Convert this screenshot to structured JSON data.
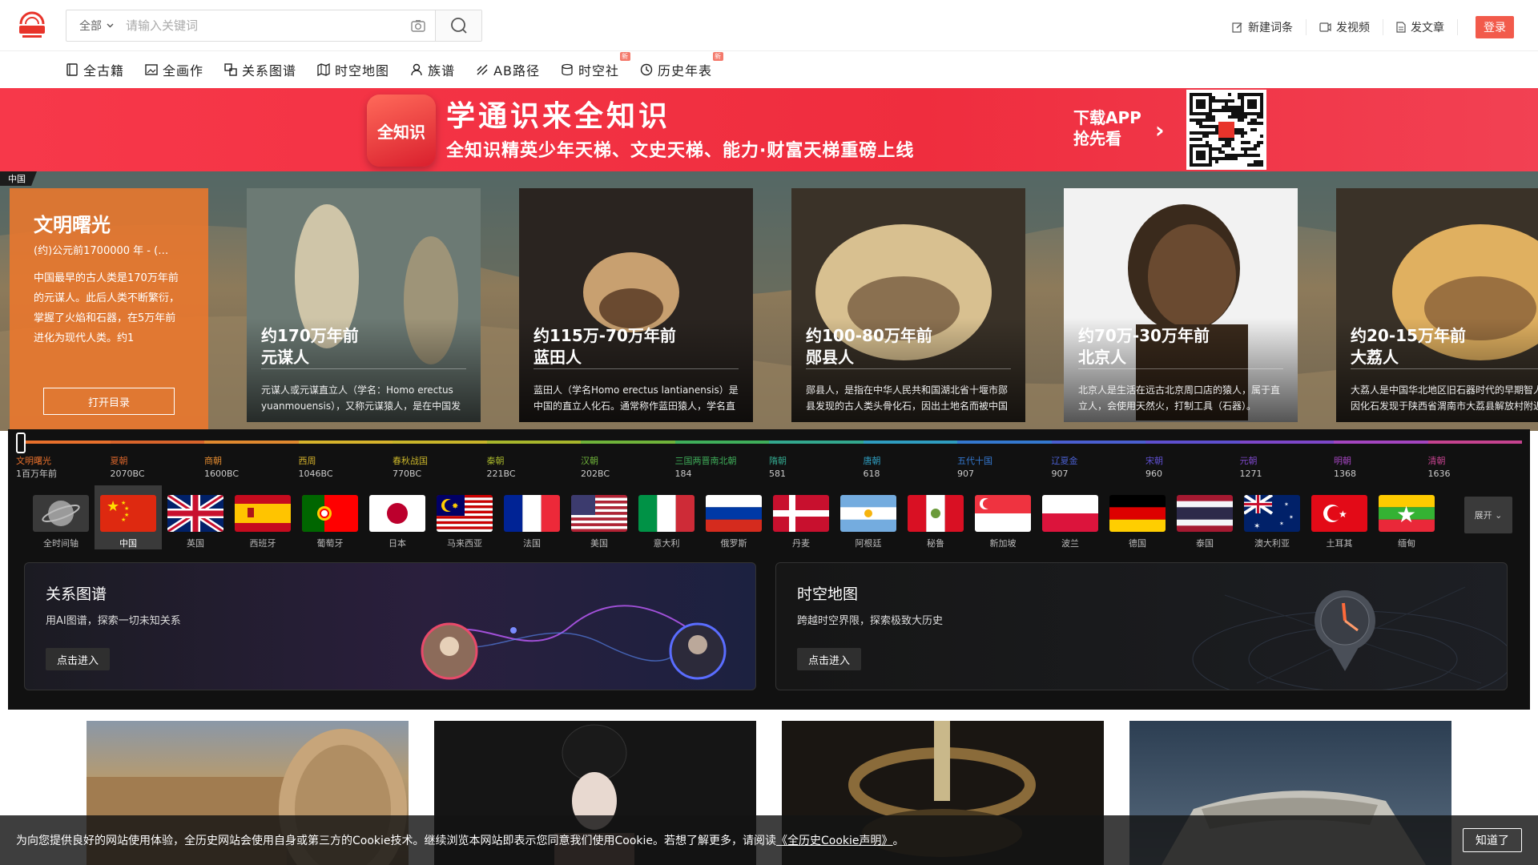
{
  "header": {
    "search_scope": "全部",
    "search_placeholder": "请输入关键词",
    "links": [
      {
        "icon": "edit-icon",
        "label": "新建词条"
      },
      {
        "icon": "video-icon",
        "label": "发视频"
      },
      {
        "icon": "article-icon",
        "label": "发文章"
      }
    ],
    "login": "登录"
  },
  "nav": [
    {
      "icon": "book-icon",
      "label": "全古籍",
      "new": false
    },
    {
      "icon": "painting-icon",
      "label": "全画作",
      "new": false
    },
    {
      "icon": "relation-icon",
      "label": "关系图谱",
      "new": false
    },
    {
      "icon": "map-icon",
      "label": "时空地图",
      "new": false
    },
    {
      "icon": "clan-icon",
      "label": "族谱",
      "new": false
    },
    {
      "icon": "path-icon",
      "label": "AB路径",
      "new": false
    },
    {
      "icon": "community-icon",
      "label": "时空社",
      "new": true
    },
    {
      "icon": "timeline-icon",
      "label": "历史年表",
      "new": true
    }
  ],
  "new_badge": "新",
  "banner": {
    "logo": "全知识",
    "headline": "学通识来全知识",
    "subline": "全知识精英少年天梯、文史天梯、能力·财富天梯重磅上线",
    "download_line1": "下载APP",
    "download_line2": "抢先看"
  },
  "hero": {
    "region_tag": "中国",
    "intro": {
      "title": "文明曙光",
      "range": "(约)公元前1700000 年 - (…",
      "desc": "中国最早的古人类是170万年前的元谋人。此后人类不断繁衍，掌握了火焰和石器，在5万年前进化为现代人类。约1",
      "button": "打开目录"
    },
    "cards": [
      {
        "period": "约170万年前",
        "name": "元谋人",
        "desc": "元谋人或元谋直立人（学名：Homo erectus yuanmouensis），又称元谋猿人，是在中国发"
      },
      {
        "period": "约115万-70万年前",
        "name": "蓝田人",
        "desc": "蓝田人（学名Homo erectus lantianensis）是中国的直立人化石。通常称作蓝田猿人，学名直"
      },
      {
        "period": "约100-80万年前",
        "name": "郧县人",
        "desc": "郧县人，是指在中华人民共和国湖北省十堰市郧县发现的古人类头骨化石，因出土地名而被中国"
      },
      {
        "period": "约70万-30万年前",
        "name": "北京人",
        "desc": "北京人是生活在远古北京周口店的猿人，属于直立人，会使用天然火，打制工具（石器）。"
      },
      {
        "period": "约20-15万年前",
        "name": "大荔人",
        "desc": "大荔人是中国华北地区旧石器时代的早期智人，因化石发现于陕西省渭南市大荔县解放村附近"
      }
    ]
  },
  "timeline": [
    {
      "name": "文明曙光",
      "year": "1百万年前",
      "color": "#e8702c"
    },
    {
      "name": "夏朝",
      "year": "2070BC",
      "color": "#d9652b"
    },
    {
      "name": "商朝",
      "year": "1600BC",
      "color": "#e0892f"
    },
    {
      "name": "西周",
      "year": "1046BC",
      "color": "#d6b32c"
    },
    {
      "name": "春秋战国",
      "year": "770BC",
      "color": "#c9b52a"
    },
    {
      "name": "秦朝",
      "year": "221BC",
      "color": "#a7b62c"
    },
    {
      "name": "汉朝",
      "year": "202BC",
      "color": "#6fb33a"
    },
    {
      "name": "三国两晋南北朝",
      "year": "184",
      "color": "#3fae5a"
    },
    {
      "name": "隋朝",
      "year": "581",
      "color": "#33a88e"
    },
    {
      "name": "唐朝",
      "year": "618",
      "color": "#2f9dc0"
    },
    {
      "name": "五代十国",
      "year": "907",
      "color": "#3478cf"
    },
    {
      "name": "辽夏金",
      "year": "907",
      "color": "#4a5fd0"
    },
    {
      "name": "宋朝",
      "year": "960",
      "color": "#5e4fcf"
    },
    {
      "name": "元朝",
      "year": "1271",
      "color": "#7d47c9"
    },
    {
      "name": "明朝",
      "year": "1368",
      "color": "#a345bf"
    },
    {
      "name": "清朝",
      "year": "1636",
      "color": "#c5438f"
    }
  ],
  "flags": [
    {
      "code": "all",
      "label": "全时间轴"
    },
    {
      "code": "cn",
      "label": "中国"
    },
    {
      "code": "gb",
      "label": "英国"
    },
    {
      "code": "es",
      "label": "西班牙"
    },
    {
      "code": "pt",
      "label": "葡萄牙"
    },
    {
      "code": "jp",
      "label": "日本"
    },
    {
      "code": "my",
      "label": "马来西亚"
    },
    {
      "code": "fr",
      "label": "法国"
    },
    {
      "code": "us",
      "label": "美国"
    },
    {
      "code": "it",
      "label": "意大利"
    },
    {
      "code": "ru",
      "label": "俄罗斯"
    },
    {
      "code": "dk",
      "label": "丹麦"
    },
    {
      "code": "ar",
      "label": "阿根廷"
    },
    {
      "code": "pe",
      "label": "秘鲁"
    },
    {
      "code": "sg",
      "label": "新加坡"
    },
    {
      "code": "pl",
      "label": "波兰"
    },
    {
      "code": "de",
      "label": "德国"
    },
    {
      "code": "th",
      "label": "泰国"
    },
    {
      "code": "au",
      "label": "澳大利亚"
    },
    {
      "code": "tr",
      "label": "土耳其"
    },
    {
      "code": "mm",
      "label": "缅甸"
    }
  ],
  "active_flag": "cn",
  "expand": "展开",
  "panels": [
    {
      "title": "关系图谱",
      "sub": "用AI图谱，探索一切未知关系",
      "button": "点击进入"
    },
    {
      "title": "时空地图",
      "sub": "跨越时空界限，探索极致大历史",
      "button": "点击进入"
    }
  ],
  "cookie": {
    "text_before": "为向您提供良好的网站使用体验，全历史网站会使用自身或第三方的Cookie技术。继续浏览本网站即表示您同意我们使用Cookie。若想了解更多，请阅读",
    "link": "《全历史Cookie声明》",
    "text_after": "。",
    "button": "知道了"
  },
  "colors": {
    "brand": "#f25a4b",
    "intro_bg": "#ec782c",
    "dark": "#111111"
  }
}
